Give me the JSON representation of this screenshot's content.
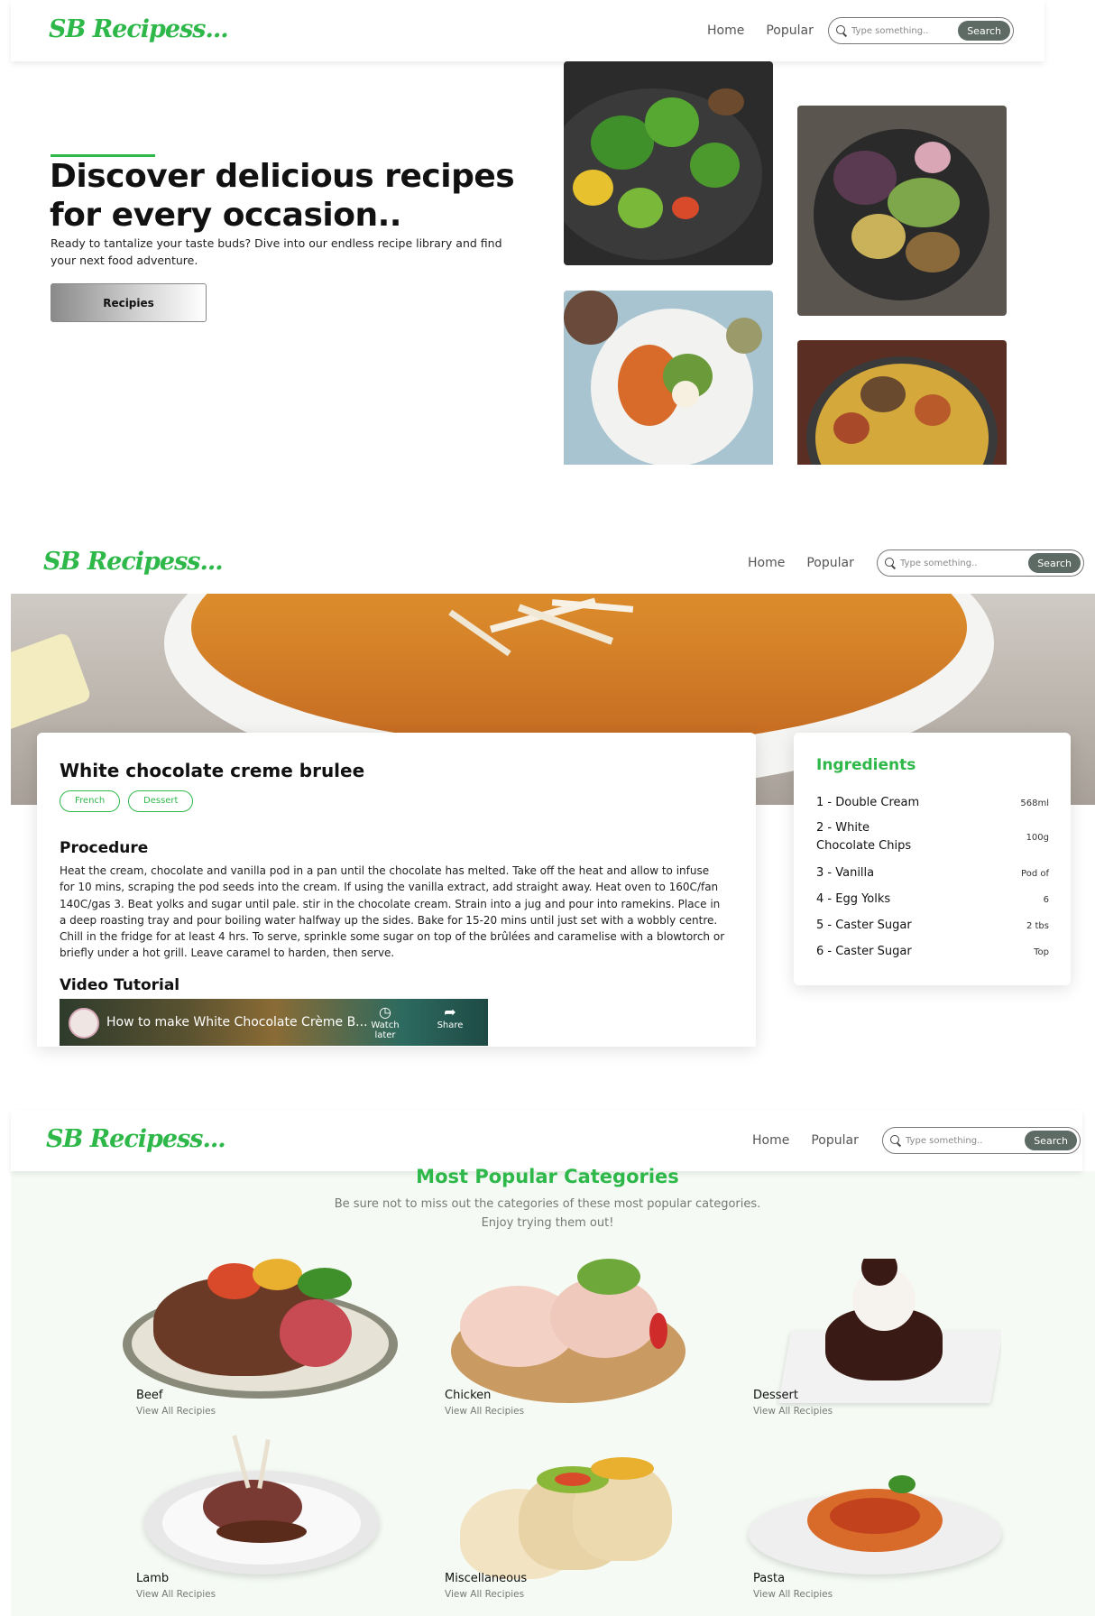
{
  "brand": {
    "logo": "SB Recipess..."
  },
  "nav": {
    "home": "Home",
    "popular": "Popular",
    "search_placeholder": "Type something..",
    "search_button": "Search"
  },
  "hero": {
    "title": "Discover delicious recipes for every occasion..",
    "text": "Ready to tantalize your taste buds? Dive into our endless recipe library and find your next food adventure.",
    "button": "Recipies"
  },
  "recipe": {
    "title": "White chocolate creme brulee",
    "tags": [
      "French",
      "Dessert"
    ],
    "procedure_heading": "Procedure",
    "procedure": "Heat the cream, chocolate and vanilla pod in a pan until the chocolate has melted. Take off the heat and allow to infuse for 10 mins, scraping the pod seeds into the cream. If using the vanilla extract, add straight away. Heat oven to 160C/fan 140C/gas 3. Beat yolks and sugar until pale. stir in the chocolate cream. Strain into a jug and pour into ramekins. Place in a deep roasting tray and pour boiling water halfway up the sides. Bake for 15-20 mins until just set with a wobbly centre. Chill in the fridge for at least 4 hrs. To serve, sprinkle some sugar on top of the brûlées and caramelise with a blowtorch or briefly under a hot grill. Leave caramel to harden, then serve.",
    "video_heading": "Video Tutorial",
    "video": {
      "title": "How to make White Chocolate Crème B...",
      "watch_later": "Watch later",
      "share": "Share"
    },
    "ingredients_heading": "Ingredients",
    "ingredients": [
      {
        "name": "1 - Double Cream",
        "qty": "568ml"
      },
      {
        "name": "2 - White Chocolate Chips",
        "qty": "100g"
      },
      {
        "name": "3 - Vanilla",
        "qty": "Pod of"
      },
      {
        "name": "4 - Egg Yolks",
        "qty": "6"
      },
      {
        "name": "5 - Caster Sugar",
        "qty": "2 tbs"
      },
      {
        "name": "6 - Caster Sugar",
        "qty": "Top"
      }
    ]
  },
  "categories": {
    "title": "Most Popular Categories",
    "subtitle_1": "Be sure not to miss out the categories of these most popular categories.",
    "subtitle_2": "Enjoy trying them out!",
    "link_text": "View All Recipies",
    "items": [
      {
        "name": "Beef"
      },
      {
        "name": "Chicken"
      },
      {
        "name": "Dessert"
      },
      {
        "name": "Lamb"
      },
      {
        "name": "Miscellaneous"
      },
      {
        "name": "Pasta"
      }
    ]
  },
  "colors": {
    "accent": "#2fb84a",
    "search_button": "#5e6b64",
    "category_bg": "#f5fbf4"
  }
}
